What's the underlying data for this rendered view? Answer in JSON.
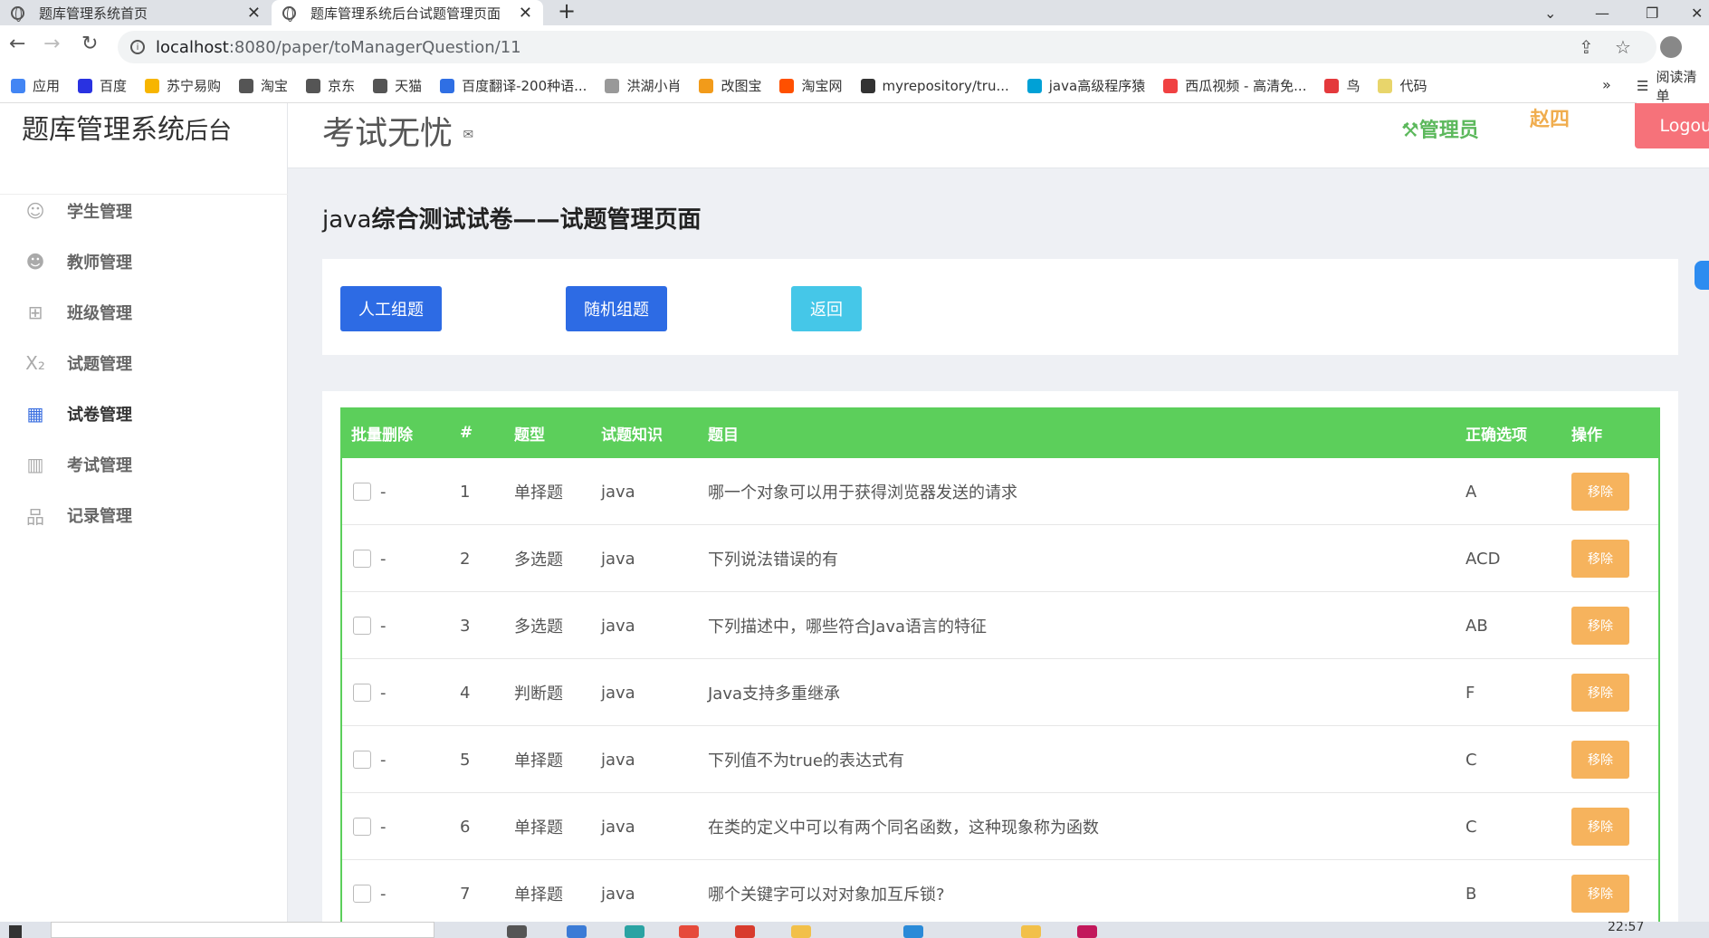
{
  "browser": {
    "tabs": [
      {
        "title": "题库管理系统首页"
      },
      {
        "title": "题库管理系统后台试题管理页面"
      }
    ],
    "url_host": "localhost",
    "url_path": ":8080/paper/toManagerQuestion/11",
    "bookmarks": [
      {
        "label": "应用",
        "color": "#4285f4"
      },
      {
        "label": "百度",
        "color": "#2932e1"
      },
      {
        "label": "苏宁易购",
        "color": "#f7b500"
      },
      {
        "label": "淘宝",
        "color": "#555555"
      },
      {
        "label": "京东",
        "color": "#555555"
      },
      {
        "label": "天猫",
        "color": "#555555"
      },
      {
        "label": "百度翻译-200种语...",
        "color": "#2f6fe4"
      },
      {
        "label": "洪湖小肖",
        "color": "#999999"
      },
      {
        "label": "改图宝",
        "color": "#f29b1a"
      },
      {
        "label": "淘宝网",
        "color": "#ff5000"
      },
      {
        "label": "myrepository/tru...",
        "color": "#333333"
      },
      {
        "label": "java高级程序猿",
        "color": "#00a1d6"
      },
      {
        "label": "西瓜视频 - 高清免...",
        "color": "#f04142"
      },
      {
        "label": "鸟",
        "color": "#e4393c"
      },
      {
        "label": "代码",
        "color": "#e8d56b"
      }
    ],
    "bookmarks_reading": "阅读清单",
    "time": "22:57"
  },
  "app": {
    "brand_main": "题库管理系统",
    "brand_sub": "后台",
    "slogan": "考试无忧",
    "role": "管理员",
    "username": "赵四",
    "logout": "Logout",
    "menu": [
      {
        "label": "学生管理",
        "icon": "smile-icon",
        "glyph": "☺"
      },
      {
        "label": "教师管理",
        "icon": "face-icon",
        "glyph": "☻"
      },
      {
        "label": "班级管理",
        "icon": "grid-icon",
        "glyph": "⊞"
      },
      {
        "label": "试题管理",
        "icon": "subscript-icon",
        "glyph": "X₂"
      },
      {
        "label": "试卷管理",
        "icon": "table-icon",
        "glyph": "▦"
      },
      {
        "label": "考试管理",
        "icon": "map-icon",
        "glyph": "▥"
      },
      {
        "label": "记录管理",
        "icon": "sitemap-icon",
        "glyph": "品"
      }
    ],
    "active_menu": 4
  },
  "page": {
    "title_prefix": "java",
    "title_main": "综合测试试卷——试题管理页面",
    "buttons": {
      "manual": "人工组题",
      "random": "随机组题",
      "back": "返回"
    },
    "table": {
      "headers": [
        "批量删除",
        "#",
        "题型",
        "试题知识",
        "题目",
        "正确选项",
        "操作"
      ],
      "rows": [
        {
          "dash": "-",
          "no": "1",
          "type": "单择题",
          "topic": "java",
          "question": "哪一个对象可以用于获得浏览器发送的请求",
          "answer": "A",
          "action": "移除"
        },
        {
          "dash": "-",
          "no": "2",
          "type": "多选题",
          "topic": "java",
          "question": "下列说法错误的有",
          "answer": "ACD",
          "action": "移除"
        },
        {
          "dash": "-",
          "no": "3",
          "type": "多选题",
          "topic": "java",
          "question": "下列描述中，哪些符合Java语言的特征",
          "answer": "AB",
          "action": "移除"
        },
        {
          "dash": "-",
          "no": "4",
          "type": "判断题",
          "topic": "java",
          "question": "Java支持多重继承",
          "answer": "F",
          "action": "移除"
        },
        {
          "dash": "-",
          "no": "5",
          "type": "单择题",
          "topic": "java",
          "question": "下列值不为true的表达式有",
          "answer": "C",
          "action": "移除"
        },
        {
          "dash": "-",
          "no": "6",
          "type": "单择题",
          "topic": "java",
          "question": "在类的定义中可以有两个同名函数，这种现象称为函数",
          "answer": "C",
          "action": "移除"
        },
        {
          "dash": "-",
          "no": "7",
          "type": "单择题",
          "topic": "java",
          "question": "哪个关键字可以对对象加互斥锁?",
          "answer": "B",
          "action": "移除"
        }
      ]
    }
  },
  "colors": {
    "header_green": "#5ccf5b",
    "primary_blue": "#2d6be4",
    "info_cyan": "#45c7e8",
    "warning_orange": "#f6b35d",
    "logout_red": "#f6727a"
  }
}
